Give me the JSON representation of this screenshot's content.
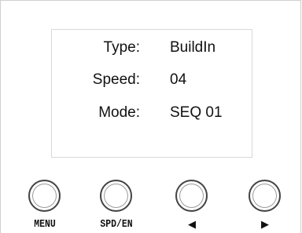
{
  "display": {
    "rows": [
      {
        "label": "Type:",
        "value": "BuildIn"
      },
      {
        "label": "Speed:",
        "value": "04"
      },
      {
        "label": "Mode:",
        "value": "SEQ 01"
      }
    ]
  },
  "buttons": {
    "menu": {
      "label": "MENU",
      "icon": "circle-button"
    },
    "spd_en": {
      "label": "SPD/EN",
      "icon": "circle-button"
    },
    "left": {
      "label": "◀",
      "icon": "left-arrow-icon"
    },
    "right": {
      "label": "▶",
      "icon": "right-arrow-icon"
    }
  },
  "colors": {
    "text": "#111111",
    "button_border": "#444444",
    "screen_border": "#d8d8d8",
    "panel_border": "#cfcfcf",
    "background": "#ffffff"
  }
}
